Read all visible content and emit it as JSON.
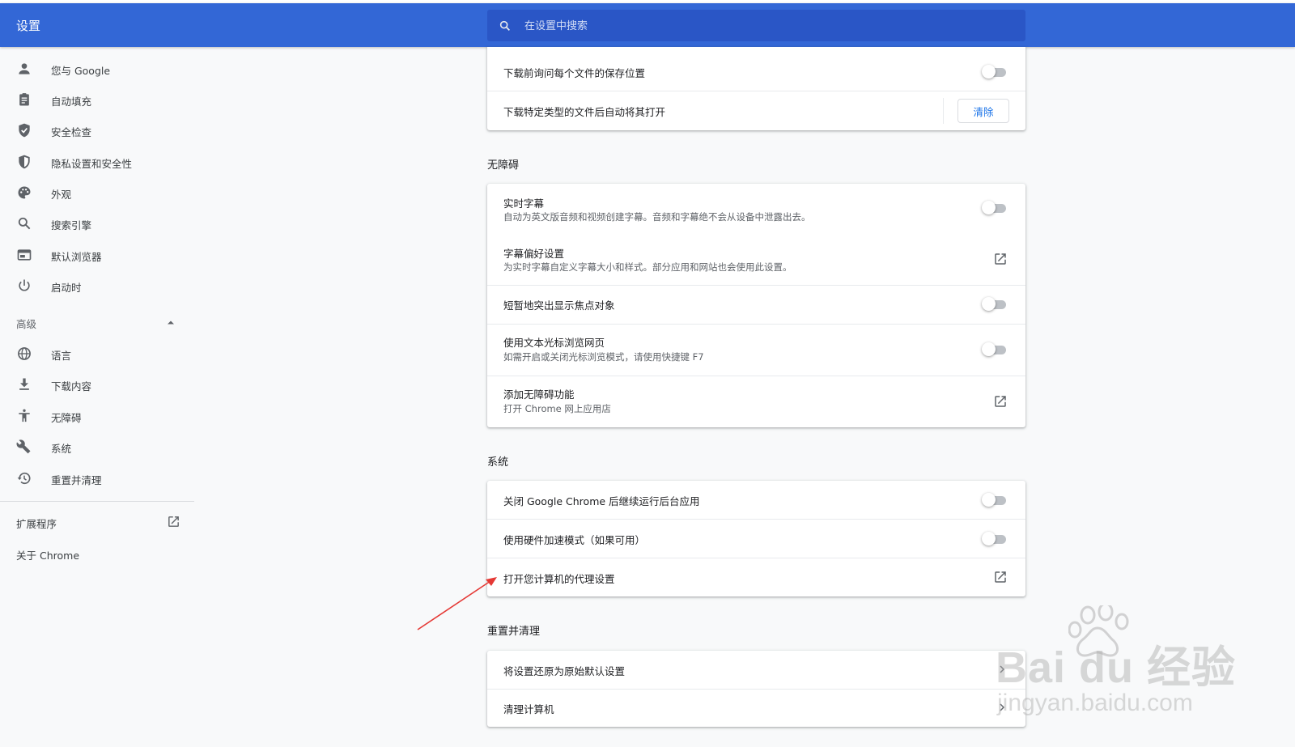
{
  "header": {
    "title": "设置",
    "search_placeholder": "在设置中搜索"
  },
  "sidebar": {
    "items": [
      {
        "label": "您与 Google",
        "icon": "person-icon"
      },
      {
        "label": "自动填充",
        "icon": "clipboard-icon"
      },
      {
        "label": "安全检查",
        "icon": "shield-check-icon"
      },
      {
        "label": "隐私设置和安全性",
        "icon": "privacy-shield-icon"
      },
      {
        "label": "外观",
        "icon": "palette-icon"
      },
      {
        "label": "搜索引擎",
        "icon": "search-icon"
      },
      {
        "label": "默认浏览器",
        "icon": "browser-icon"
      },
      {
        "label": "启动时",
        "icon": "power-icon"
      }
    ],
    "advanced_label": "高级",
    "advanced_items": [
      {
        "label": "语言",
        "icon": "globe-icon"
      },
      {
        "label": "下载内容",
        "icon": "download-icon"
      },
      {
        "label": "无障碍",
        "icon": "accessibility-icon"
      },
      {
        "label": "系统",
        "icon": "wrench-icon"
      },
      {
        "label": "重置并清理",
        "icon": "restore-icon"
      }
    ],
    "extensions_label": "扩展程序",
    "about_label": "关于 Chrome"
  },
  "downloads": {
    "ask_location": "下载前询问每个文件的保存位置",
    "auto_open": "下载特定类型的文件后自动将其打开",
    "clear_button": "清除"
  },
  "accessibility": {
    "title": "无障碍",
    "live_caption_title": "实时字幕",
    "live_caption_sub": "自动为英文版音频和视频创建字幕。音频和字幕绝不会从设备中泄露出去。",
    "caption_pref_title": "字幕偏好设置",
    "caption_pref_sub": "为实时字幕自定义字幕大小和样式。部分应用和网站也会使用此设置。",
    "focus_highlight": "短暂地突出显示焦点对象",
    "caret_title": "使用文本光标浏览网页",
    "caret_sub": "如需开启或关闭光标浏览模式，请使用快捷键 F7",
    "add_features_title": "添加无障碍功能",
    "add_features_sub": "打开 Chrome 网上应用店"
  },
  "system": {
    "title": "系统",
    "background_apps": "关闭 Google Chrome 后继续运行后台应用",
    "hardware_accel": "使用硬件加速模式（如果可用）",
    "proxy": "打开您计算机的代理设置"
  },
  "reset": {
    "title": "重置并清理",
    "restore": "将设置还原为原始默认设置",
    "cleanup": "清理计算机"
  },
  "toggles": {
    "ask_location": false,
    "live_caption": false,
    "focus_highlight": false,
    "caret_browsing": false,
    "background_apps": false,
    "hardware_accel": false
  },
  "watermark": {
    "logo": "Bai du 经验",
    "url": "jingyan.baidu.com"
  },
  "colors": {
    "header": "#3367d6",
    "search": "#2a56c6",
    "accent": "#1a73e8",
    "annotation_arrow": "#e53935"
  }
}
